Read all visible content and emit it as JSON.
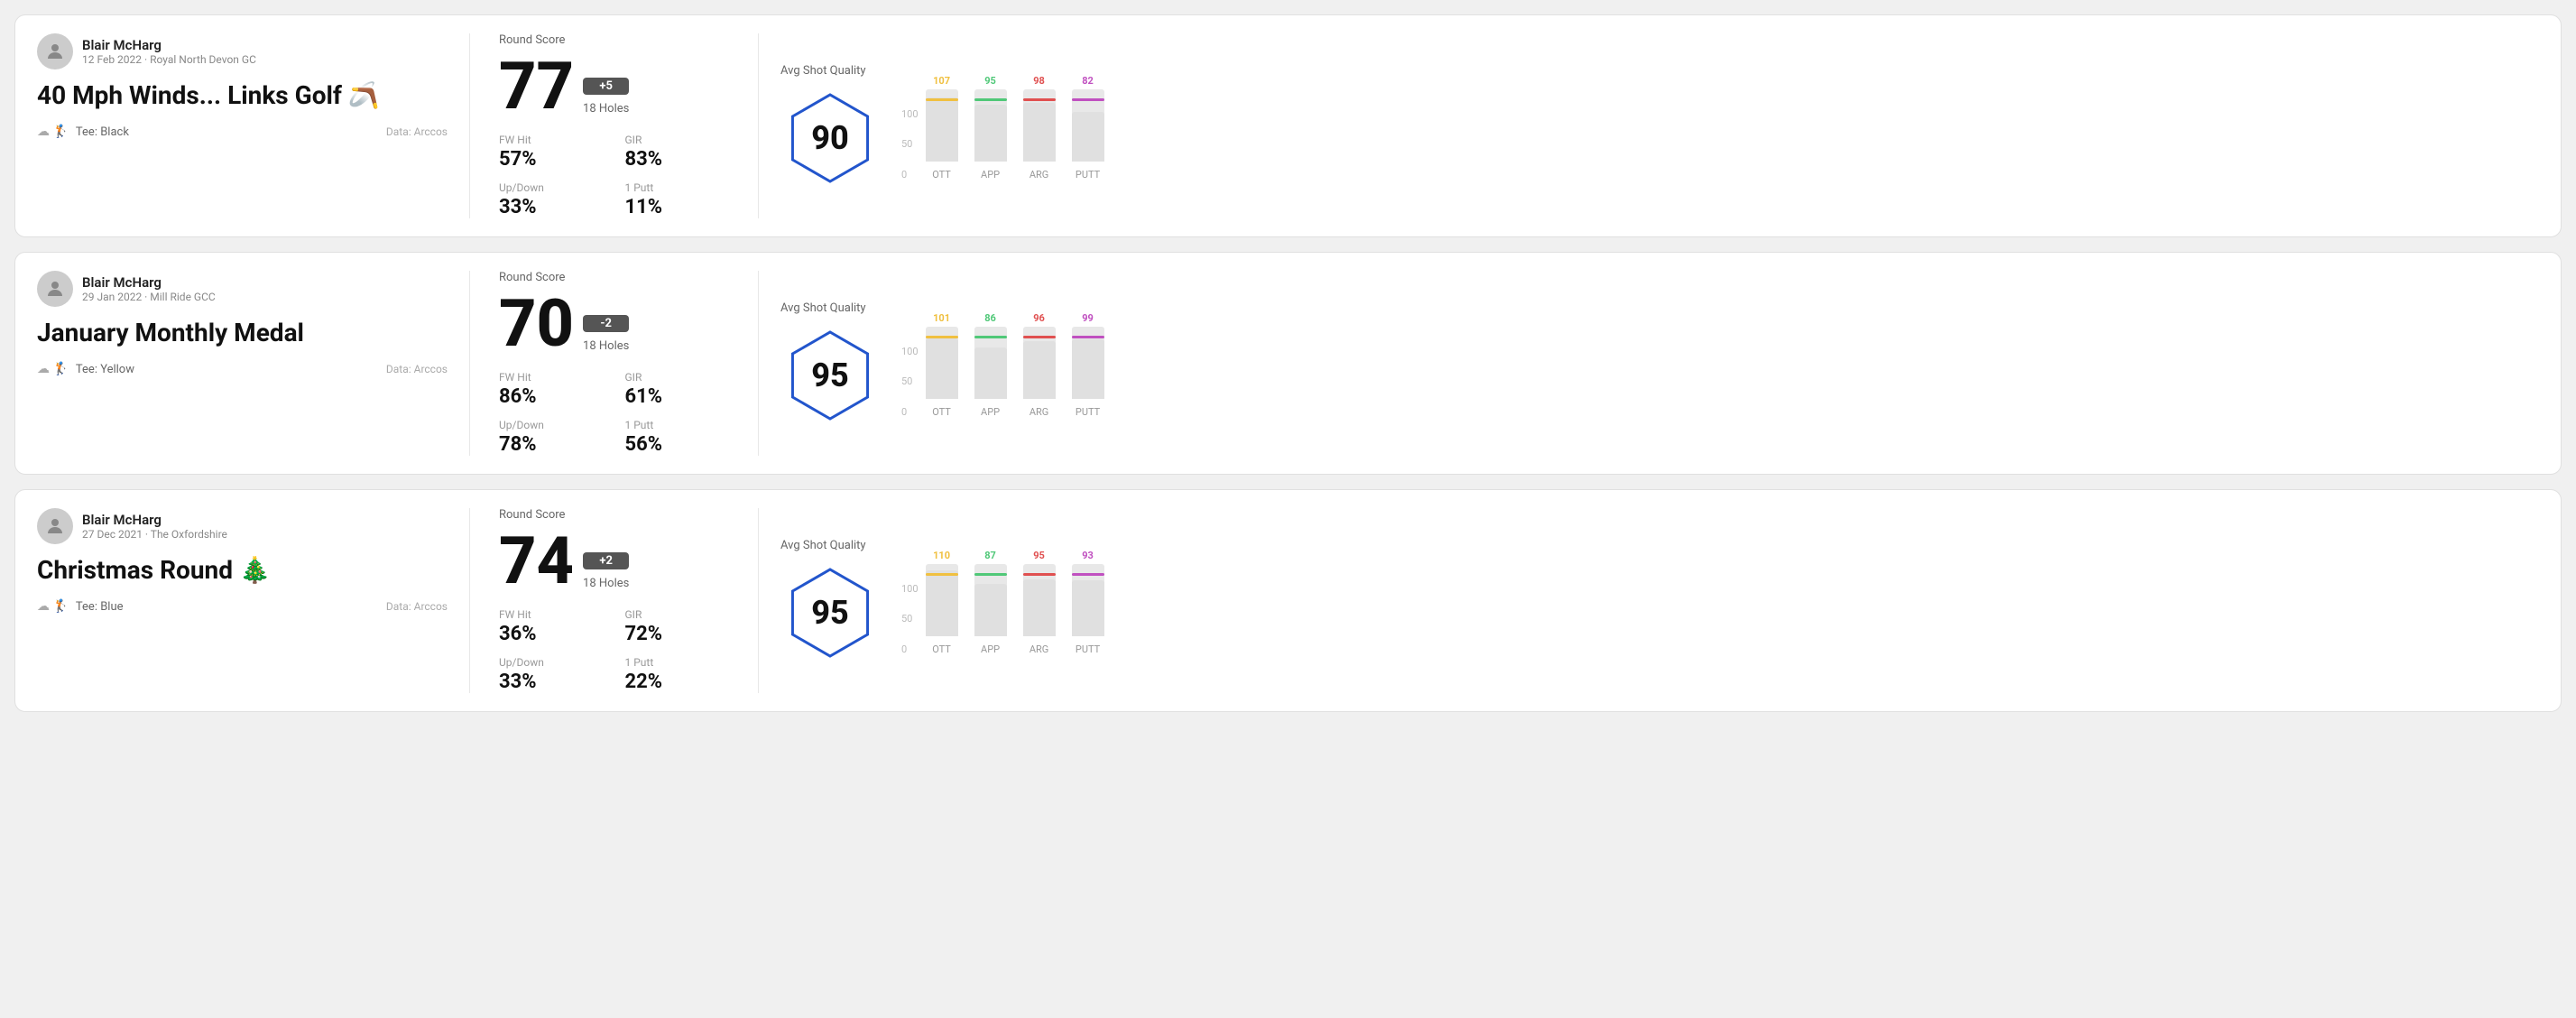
{
  "rounds": [
    {
      "id": "round1",
      "user": {
        "name": "Blair McHarg",
        "date_course": "12 Feb 2022 · Royal North Devon GC"
      },
      "title": "40 Mph Winds... Links Golf 🪃",
      "tee": "Black",
      "data_source": "Data: Arccos",
      "score": "77",
      "score_diff": "+5",
      "holes": "18 Holes",
      "fw_hit": "57%",
      "gir": "83%",
      "up_down": "33%",
      "one_putt": "11%",
      "avg_shot_quality": "90",
      "bars": [
        {
          "label": "OTT",
          "value": 107,
          "color": "#f0c040"
        },
        {
          "label": "APP",
          "value": 95,
          "color": "#50c878"
        },
        {
          "label": "ARG",
          "value": 98,
          "color": "#e05050"
        },
        {
          "label": "PUTT",
          "value": 82,
          "color": "#c050c0"
        }
      ]
    },
    {
      "id": "round2",
      "user": {
        "name": "Blair McHarg",
        "date_course": "29 Jan 2022 · Mill Ride GCC"
      },
      "title": "January Monthly Medal",
      "tee": "Yellow",
      "data_source": "Data: Arccos",
      "score": "70",
      "score_diff": "-2",
      "holes": "18 Holes",
      "fw_hit": "86%",
      "gir": "61%",
      "up_down": "78%",
      "one_putt": "56%",
      "avg_shot_quality": "95",
      "bars": [
        {
          "label": "OTT",
          "value": 101,
          "color": "#f0c040"
        },
        {
          "label": "APP",
          "value": 86,
          "color": "#50c878"
        },
        {
          "label": "ARG",
          "value": 96,
          "color": "#e05050"
        },
        {
          "label": "PUTT",
          "value": 99,
          "color": "#c050c0"
        }
      ]
    },
    {
      "id": "round3",
      "user": {
        "name": "Blair McHarg",
        "date_course": "27 Dec 2021 · The Oxfordshire"
      },
      "title": "Christmas Round 🎄",
      "tee": "Blue",
      "data_source": "Data: Arccos",
      "score": "74",
      "score_diff": "+2",
      "holes": "18 Holes",
      "fw_hit": "36%",
      "gir": "72%",
      "up_down": "33%",
      "one_putt": "22%",
      "avg_shot_quality": "95",
      "bars": [
        {
          "label": "OTT",
          "value": 110,
          "color": "#f0c040"
        },
        {
          "label": "APP",
          "value": 87,
          "color": "#50c878"
        },
        {
          "label": "ARG",
          "value": 95,
          "color": "#e05050"
        },
        {
          "label": "PUTT",
          "value": 93,
          "color": "#c050c0"
        }
      ]
    }
  ],
  "labels": {
    "round_score": "Round Score",
    "fw_hit": "FW Hit",
    "gir": "GIR",
    "up_down": "Up/Down",
    "one_putt": "1 Putt",
    "avg_shot_quality": "Avg Shot Quality",
    "data_arccos": "Data: Arccos",
    "tee_label": "Tee:",
    "y_axis": [
      "100",
      "50",
      "0"
    ]
  }
}
